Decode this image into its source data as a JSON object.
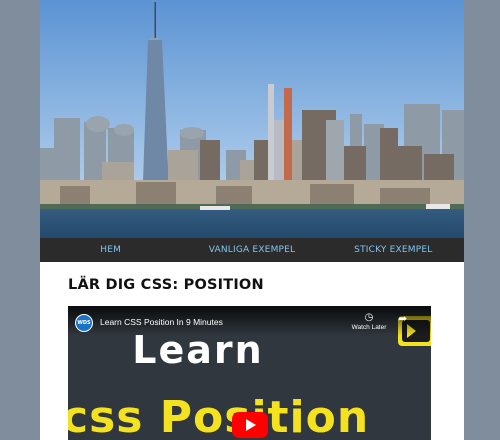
{
  "nav": {
    "items": [
      {
        "label": "HEM"
      },
      {
        "label": "VANLIGA EXEMPEL"
      },
      {
        "label": "STICKY EXEMPEL"
      }
    ]
  },
  "page": {
    "title": "LÄR DIG CSS: POSITION"
  },
  "video": {
    "channel_logo": "WDS",
    "title": "Learn CSS Position In 9 Minutes",
    "watch_later": "Watch Later",
    "thumbnail_line1": "Learn",
    "thumbnail_line2": "css Position",
    "icons": [
      "clock-icon",
      "share-icon",
      "play-icon"
    ]
  },
  "colors": {
    "nav_bg": "#2b2b2b",
    "nav_text": "#7fc6ef",
    "outer_bg": "#7f8d9c",
    "thumb_yellow": "#f5e21f",
    "youtube_red": "#ff0000"
  }
}
